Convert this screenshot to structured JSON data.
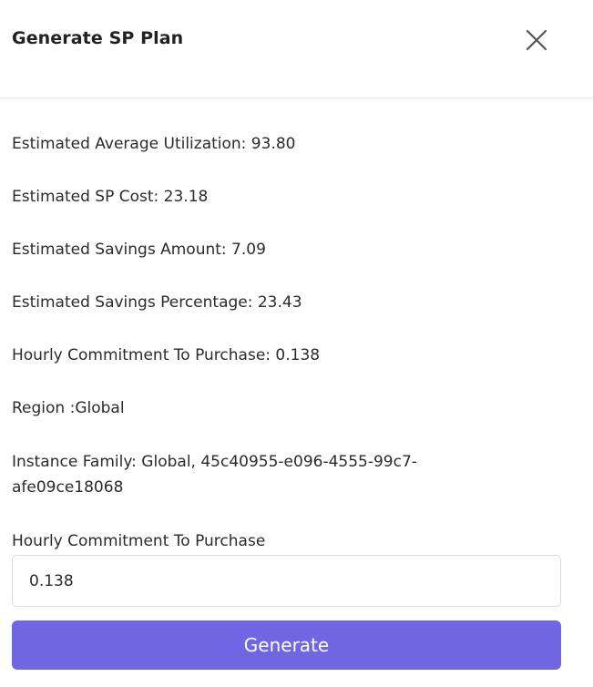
{
  "dialog": {
    "title": "Generate SP Plan",
    "close_icon": "close-icon"
  },
  "stats": {
    "avg_utilization": "Estimated Average Utilization: 93.80",
    "sp_cost": "Estimated SP Cost: 23.18",
    "savings_amount": "Estimated Savings Amount: 7.09",
    "savings_percentage": "Estimated Savings Percentage: 23.43",
    "hourly_commitment": "Hourly Commitment To Purchase: 0.138",
    "region": "Region :Global",
    "instance_family": "Instance Family: Global, 45c40955-e096-4555-99c7-afe09ce18068"
  },
  "form": {
    "hourly_commitment_label": "Hourly Commitment To Purchase",
    "hourly_commitment_value": "0.138",
    "generate_label": "Generate"
  },
  "colors": {
    "accent": "#7066e4",
    "text": "#2b2b2b",
    "divider": "#ececec",
    "input_border": "#dcdcdc"
  }
}
